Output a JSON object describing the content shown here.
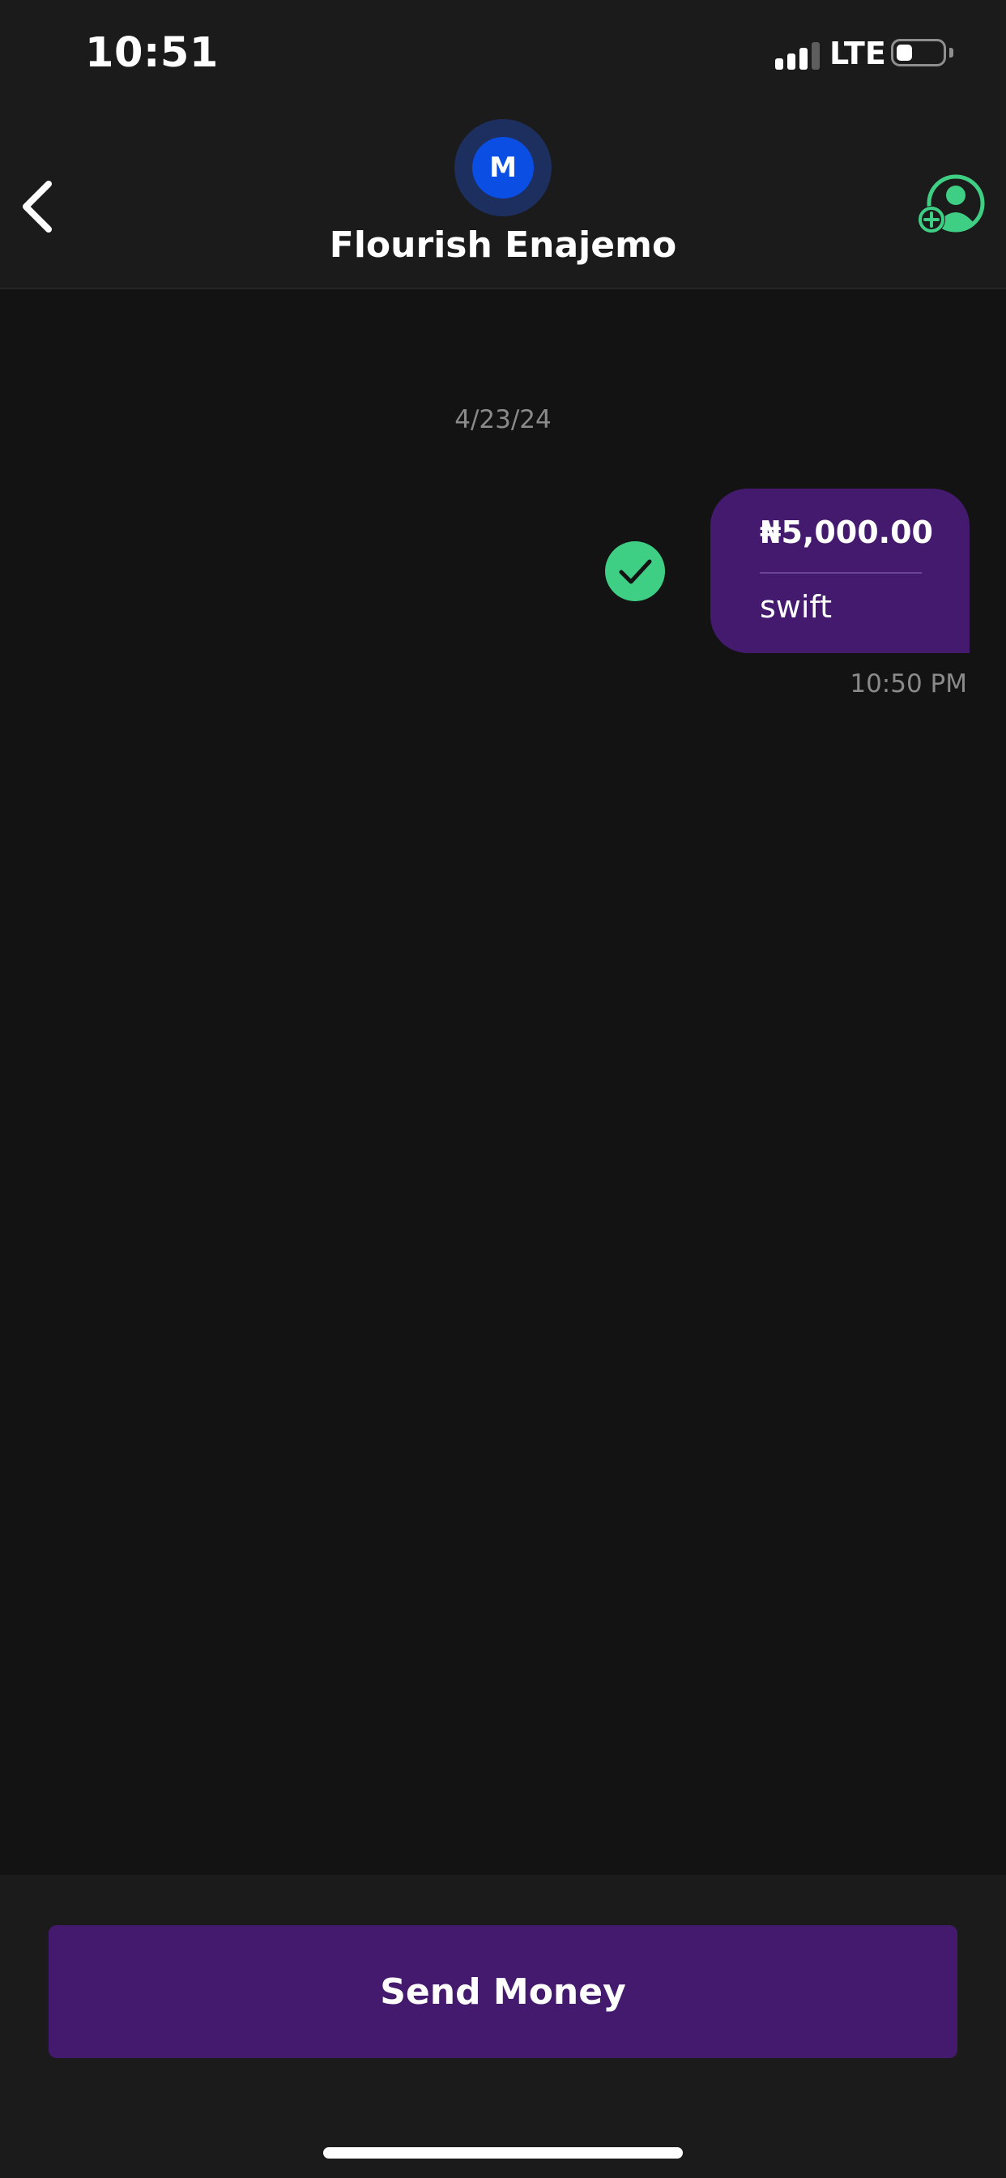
{
  "status_bar": {
    "time": "10:51",
    "network": "LTE",
    "battery_level": 0.35
  },
  "header": {
    "avatar_initial": "M",
    "contact_name": "Flourish Enajemo",
    "icons": {
      "back": "chevron-left-icon",
      "add_contact": "add-user-icon"
    }
  },
  "chat": {
    "date": "4/23/24",
    "messages": [
      {
        "amount": "₦5,000.00",
        "note": "swift",
        "time": "10:50 PM",
        "status_icon": "check-icon",
        "status_color": "#3ecf85"
      }
    ]
  },
  "footer": {
    "send_button_label": "Send Money"
  },
  "colors": {
    "background": "#131313",
    "surface": "#1b1b1b",
    "accent_purple": "#431a6e",
    "avatar_blue": "#0a4ee4",
    "success_green": "#3ecf85",
    "muted_text": "#8a8a8a"
  }
}
